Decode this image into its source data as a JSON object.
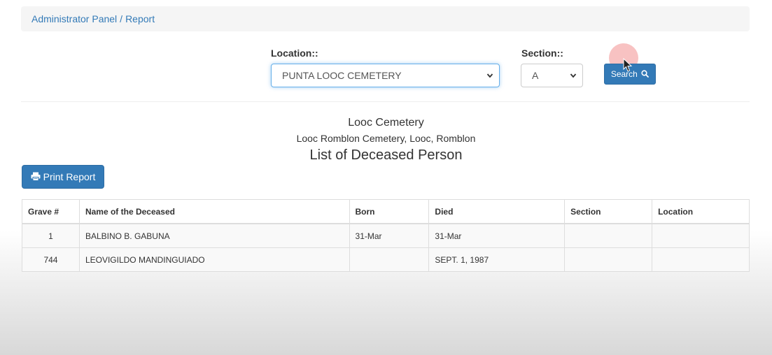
{
  "breadcrumb": {
    "admin_panel": "Administrator Panel",
    "separator": "/",
    "report": "Report"
  },
  "filters": {
    "location_label": "Location::",
    "location_value": "PUNTA LOOC CEMETERY",
    "section_label": "Section::",
    "section_value": "A",
    "search_button": "Search"
  },
  "report": {
    "cemetery_name": "Looc Cemetery",
    "address": "Looc Romblon Cemetery, Looc, Romblon",
    "title": "List of Deceased Person",
    "print_button": "Print Report"
  },
  "table": {
    "columns": [
      "Grave #",
      "Name of the Deceased",
      "Born",
      "Died",
      "Section",
      "Location"
    ],
    "rows": [
      {
        "grave": "1",
        "name": "BALBINO B. GABUNA",
        "born": "31-Mar",
        "died": "31-Mar",
        "section": "",
        "location": ""
      },
      {
        "grave": "744",
        "name": "LEOVIGILDO MANDINGUIADO",
        "born": "",
        "died": "SEPT. 1, 1987",
        "section": "",
        "location": ""
      }
    ]
  },
  "icons": {
    "search": "search-icon",
    "print": "print-icon",
    "chevron": "chevron-down-icon",
    "cursor": "mouse-cursor-icon"
  },
  "colors": {
    "primary": "#337ab7",
    "link": "#337ab7",
    "breadcrumb_bg": "#f5f5f5",
    "focus": "#66afe9"
  }
}
